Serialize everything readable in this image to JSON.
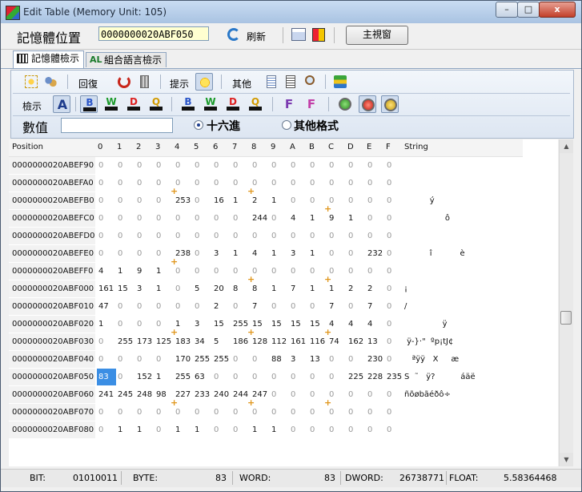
{
  "window": {
    "title": "Edit Table (Memory Unit: 105)",
    "min_label": "–",
    "max_label": "□",
    "close_label": "x"
  },
  "toolbar": {
    "address_label": "記憶體位置",
    "address_value": "0000000020ABF050",
    "refresh_label": "刷新",
    "main_view_label": "主視窗"
  },
  "tabs": [
    {
      "label": "記憶體檢示",
      "icon": "grid-icon",
      "active": true
    },
    {
      "label": "組合語言檢示",
      "icon": "asm-icon",
      "active": false
    }
  ],
  "panel": {
    "restore_label": "回復",
    "hint_label": "提示",
    "other_label": "其他",
    "view_label": "檢示",
    "value_label": "數值",
    "value_input": "",
    "radio_hex_label": "十六進",
    "radio_other_label": "其他格式",
    "format_buttons": [
      "B",
      "W",
      "D",
      "Q",
      "B",
      "W",
      "D",
      "Q"
    ],
    "float_buttons": [
      "F",
      "F"
    ]
  },
  "grid": {
    "position_header": "Position",
    "col_headers": [
      "0",
      "1",
      "2",
      "3",
      "4",
      "5",
      "6",
      "7",
      "8",
      "9",
      "A",
      "B",
      "C",
      "D",
      "E",
      "F"
    ],
    "string_header": "String",
    "rows": [
      {
        "pos": "0000000020ABEF90",
        "bytes": [
          "0",
          "0",
          "0",
          "0",
          "0",
          "0",
          "0",
          "0",
          "0",
          "0",
          "0",
          "0",
          "0",
          "0",
          "0",
          "0"
        ],
        "str": ""
      },
      {
        "pos": "0000000020ABEFA0",
        "bytes": [
          "0",
          "0",
          "0",
          "0",
          "0",
          "0",
          "0",
          "0",
          "0",
          "0",
          "0",
          "0",
          "0",
          "0",
          "0",
          "0"
        ],
        "str": ""
      },
      {
        "pos": "0000000020ABEFB0",
        "bytes": [
          "0",
          "0",
          "0",
          "0",
          "253",
          "0",
          "16",
          "1",
          "2",
          "1",
          "0",
          "0",
          "0",
          "0",
          "0",
          "0"
        ],
        "str": "          ý"
      },
      {
        "pos": "0000000020ABEFC0",
        "bytes": [
          "0",
          "0",
          "0",
          "0",
          "0",
          "0",
          "0",
          "0",
          "244",
          "0",
          "4",
          "1",
          "9",
          "1",
          "0",
          "0"
        ],
        "str": "                ô"
      },
      {
        "pos": "0000000020ABEFD0",
        "bytes": [
          "0",
          "0",
          "0",
          "0",
          "0",
          "0",
          "0",
          "0",
          "0",
          "0",
          "0",
          "0",
          "0",
          "0",
          "0",
          "0"
        ],
        "str": ""
      },
      {
        "pos": "0000000020ABEFE0",
        "bytes": [
          "0",
          "0",
          "0",
          "0",
          "238",
          "0",
          "3",
          "1",
          "4",
          "1",
          "3",
          "1",
          "0",
          "0",
          "232",
          "0"
        ],
        "str": "          î           è"
      },
      {
        "pos": "0000000020ABEFF0",
        "bytes": [
          "4",
          "1",
          "9",
          "1",
          "0",
          "0",
          "0",
          "0",
          "0",
          "0",
          "0",
          "0",
          "0",
          "0",
          "0",
          "0"
        ],
        "str": ""
      },
      {
        "pos": "0000000020ABF000",
        "bytes": [
          "161",
          "15",
          "3",
          "1",
          "0",
          "5",
          "20",
          "8",
          "8",
          "1",
          "7",
          "1",
          "1",
          "2",
          "2",
          "0"
        ],
        "str": "¡"
      },
      {
        "pos": "0000000020ABF010",
        "bytes": [
          "47",
          "0",
          "0",
          "0",
          "0",
          "0",
          "2",
          "0",
          "7",
          "0",
          "0",
          "0",
          "7",
          "0",
          "7",
          "0"
        ],
        "str": "/"
      },
      {
        "pos": "0000000020ABF020",
        "bytes": [
          "1",
          "0",
          "0",
          "0",
          "1",
          "3",
          "15",
          "255",
          "15",
          "15",
          "15",
          "15",
          "4",
          "4",
          "4",
          "0"
        ],
        "str": "               ÿ"
      },
      {
        "pos": "0000000020ABF030",
        "bytes": [
          "0",
          "255",
          "173",
          "125",
          "183",
          "34",
          "5",
          "186",
          "128",
          "112",
          "161",
          "116",
          "74",
          "162",
          "13",
          "0"
        ],
        "str": " ÿ-}·\"  ºp¡tJ¢"
      },
      {
        "pos": "0000000020ABF040",
        "bytes": [
          "0",
          "0",
          "0",
          "0",
          "170",
          "255",
          "255",
          "0",
          "0",
          "88",
          "3",
          "13",
          "0",
          "0",
          "230",
          "0"
        ],
        "str": "   ªÿÿ   X     æ"
      },
      {
        "pos": "0000000020ABF050",
        "bytes": [
          "83",
          "0",
          "152",
          "1",
          "255",
          "63",
          "0",
          "0",
          "0",
          "0",
          "0",
          "0",
          "0",
          "225",
          "228",
          "235"
        ],
        "str": "S  ˜   ÿ?          áäë"
      },
      {
        "pos": "0000000020ABF060",
        "bytes": [
          "241",
          "245",
          "248",
          "98",
          "227",
          "233",
          "240",
          "244",
          "247",
          "0",
          "0",
          "0",
          "0",
          "0",
          "0",
          "0"
        ],
        "str": "ñõøbãéðô÷"
      },
      {
        "pos": "0000000020ABF070",
        "bytes": [
          "0",
          "0",
          "0",
          "0",
          "0",
          "0",
          "0",
          "0",
          "0",
          "0",
          "0",
          "0",
          "0",
          "0",
          "0",
          "0"
        ],
        "str": ""
      },
      {
        "pos": "0000000020ABF080",
        "bytes": [
          "0",
          "1",
          "1",
          "0",
          "1",
          "1",
          "0",
          "0",
          "1",
          "1",
          "0",
          "0",
          "0",
          "0",
          "0",
          "0"
        ],
        "str": ""
      }
    ]
  },
  "status": {
    "bit_label": "BIT:",
    "bit_value": "01010011",
    "byte_label": "BYTE:",
    "byte_value": "83",
    "word_label": "WORD:",
    "word_value": "83",
    "dword_label": "DWORD:",
    "dword_value": "26738771",
    "float_label": "FLOAT:",
    "float_value": "5.58364468"
  },
  "colors": {
    "selection": "#3b8ee4",
    "marker": "#e0961c",
    "address_bg": "#ffffd0"
  }
}
